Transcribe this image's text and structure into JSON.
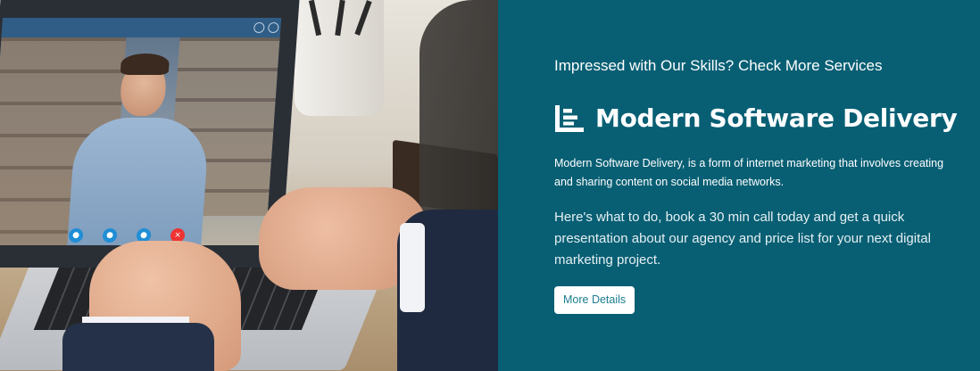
{
  "photo": {
    "alt_subject": "laptop-video-call-photo"
  },
  "content": {
    "kicker": "Impressed with Our Skills? Check More Services",
    "heading_icon": "bar-chart-list-icon",
    "heading": "Modern Software Delivery",
    "description": "Modern Software Delivery, is a form of internet marketing that involves creating and sharing content on social media networks.",
    "pitch": "Here's what to do, book a 30 min call today and get a quick presentation about our agency and price list for your next digital marketing project.",
    "cta_label": "More Details"
  },
  "colors": {
    "background": "#085f74",
    "button_bg": "#ffffff",
    "button_text": "#1b7d8f",
    "text": "#ffffff"
  }
}
